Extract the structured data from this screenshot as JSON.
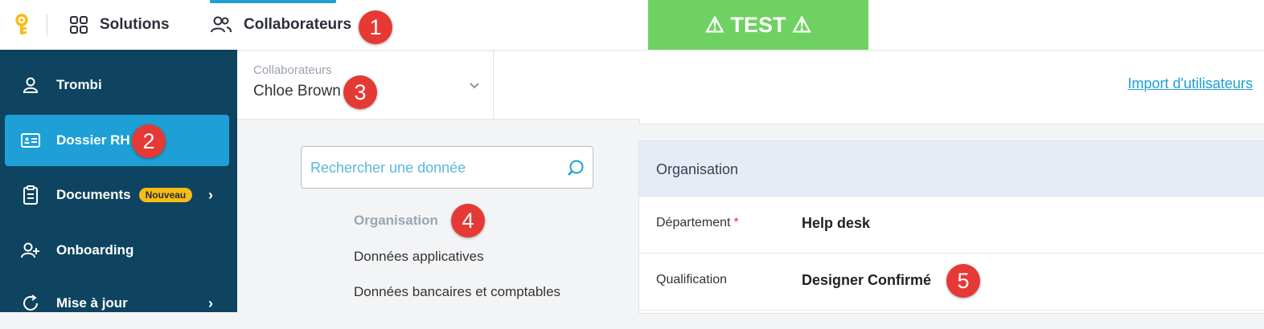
{
  "topbar": {
    "solutions_label": "Solutions",
    "collaborateurs_label": "Collaborateurs",
    "test_banner": "⚠ TEST ⚠"
  },
  "annotations": [
    "1",
    "2",
    "3",
    "4",
    "5"
  ],
  "sidebar": {
    "items": [
      {
        "label": "Trombi",
        "icon": "user-icon"
      },
      {
        "label": "Dossier RH",
        "icon": "id-card-icon",
        "active": true
      },
      {
        "label": "Documents",
        "icon": "clipboard-icon",
        "badge": "Nouveau"
      },
      {
        "label": "Onboarding",
        "icon": "user-plus-icon"
      },
      {
        "label": "Mise à jour",
        "icon": "refresh-icon"
      }
    ]
  },
  "selector": {
    "label": "Collaborateurs",
    "value": "Chloe Brown"
  },
  "import_link": "Import d'utilisateurs",
  "search": {
    "placeholder": "Rechercher une donnée"
  },
  "section_menu": [
    "Organisation",
    "Données applicatives",
    "Données bancaires et comptables"
  ],
  "card": {
    "title": "Organisation",
    "rows": [
      {
        "label": "Département",
        "required": "*",
        "value": "Help desk"
      },
      {
        "label": "Qualification",
        "value": "Designer Confirmé"
      }
    ]
  },
  "colors": {
    "sidebar_bg": "#0e4460",
    "accent": "#1e9fd6",
    "test_green": "#6fd161",
    "badge_red": "#e53935",
    "new_badge": "#f6bd16"
  }
}
